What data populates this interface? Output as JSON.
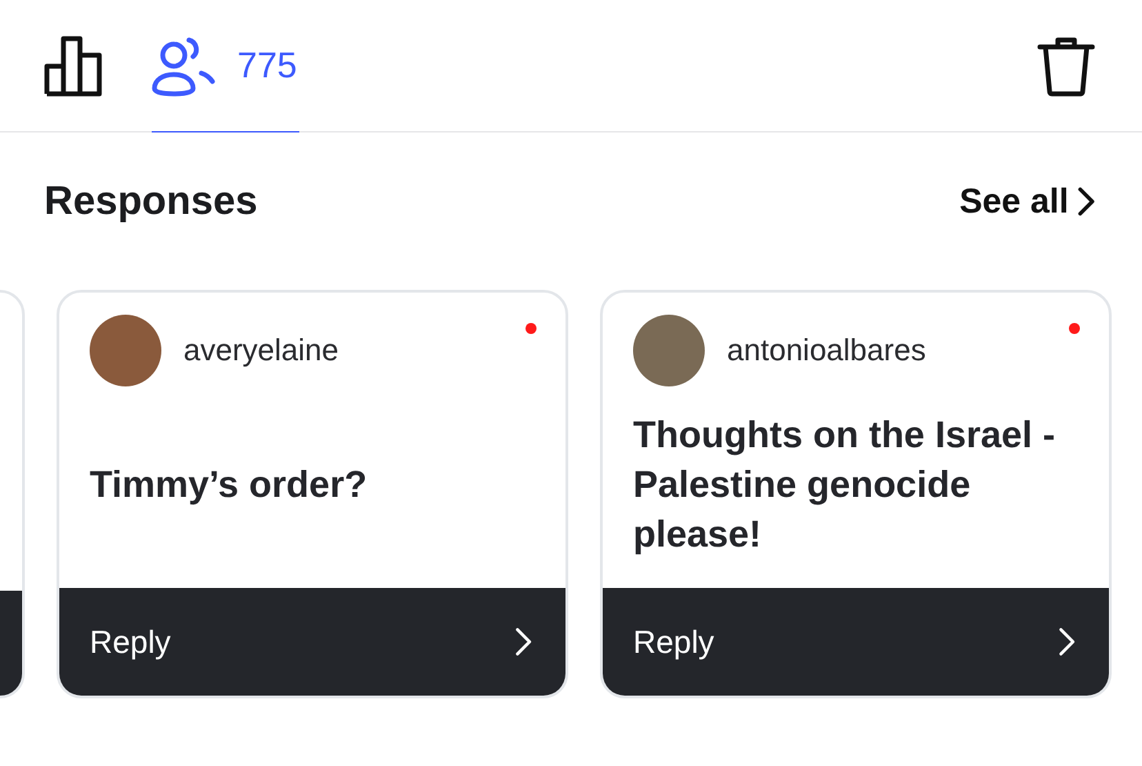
{
  "tabs": [
    {
      "kind": "stats",
      "selected": false
    },
    {
      "kind": "people",
      "selected": true,
      "count": "775"
    }
  ],
  "section": {
    "title": "Responses",
    "link": "See all"
  },
  "responses": [
    {
      "username": "averyelaine",
      "unread": true,
      "question": "Timmy’s order?",
      "action": "Reply"
    },
    {
      "username": "antonioalbares",
      "unread": true,
      "question": "Thoughts on the Israel - Palestine genocide please!",
      "action": "Reply"
    }
  ]
}
